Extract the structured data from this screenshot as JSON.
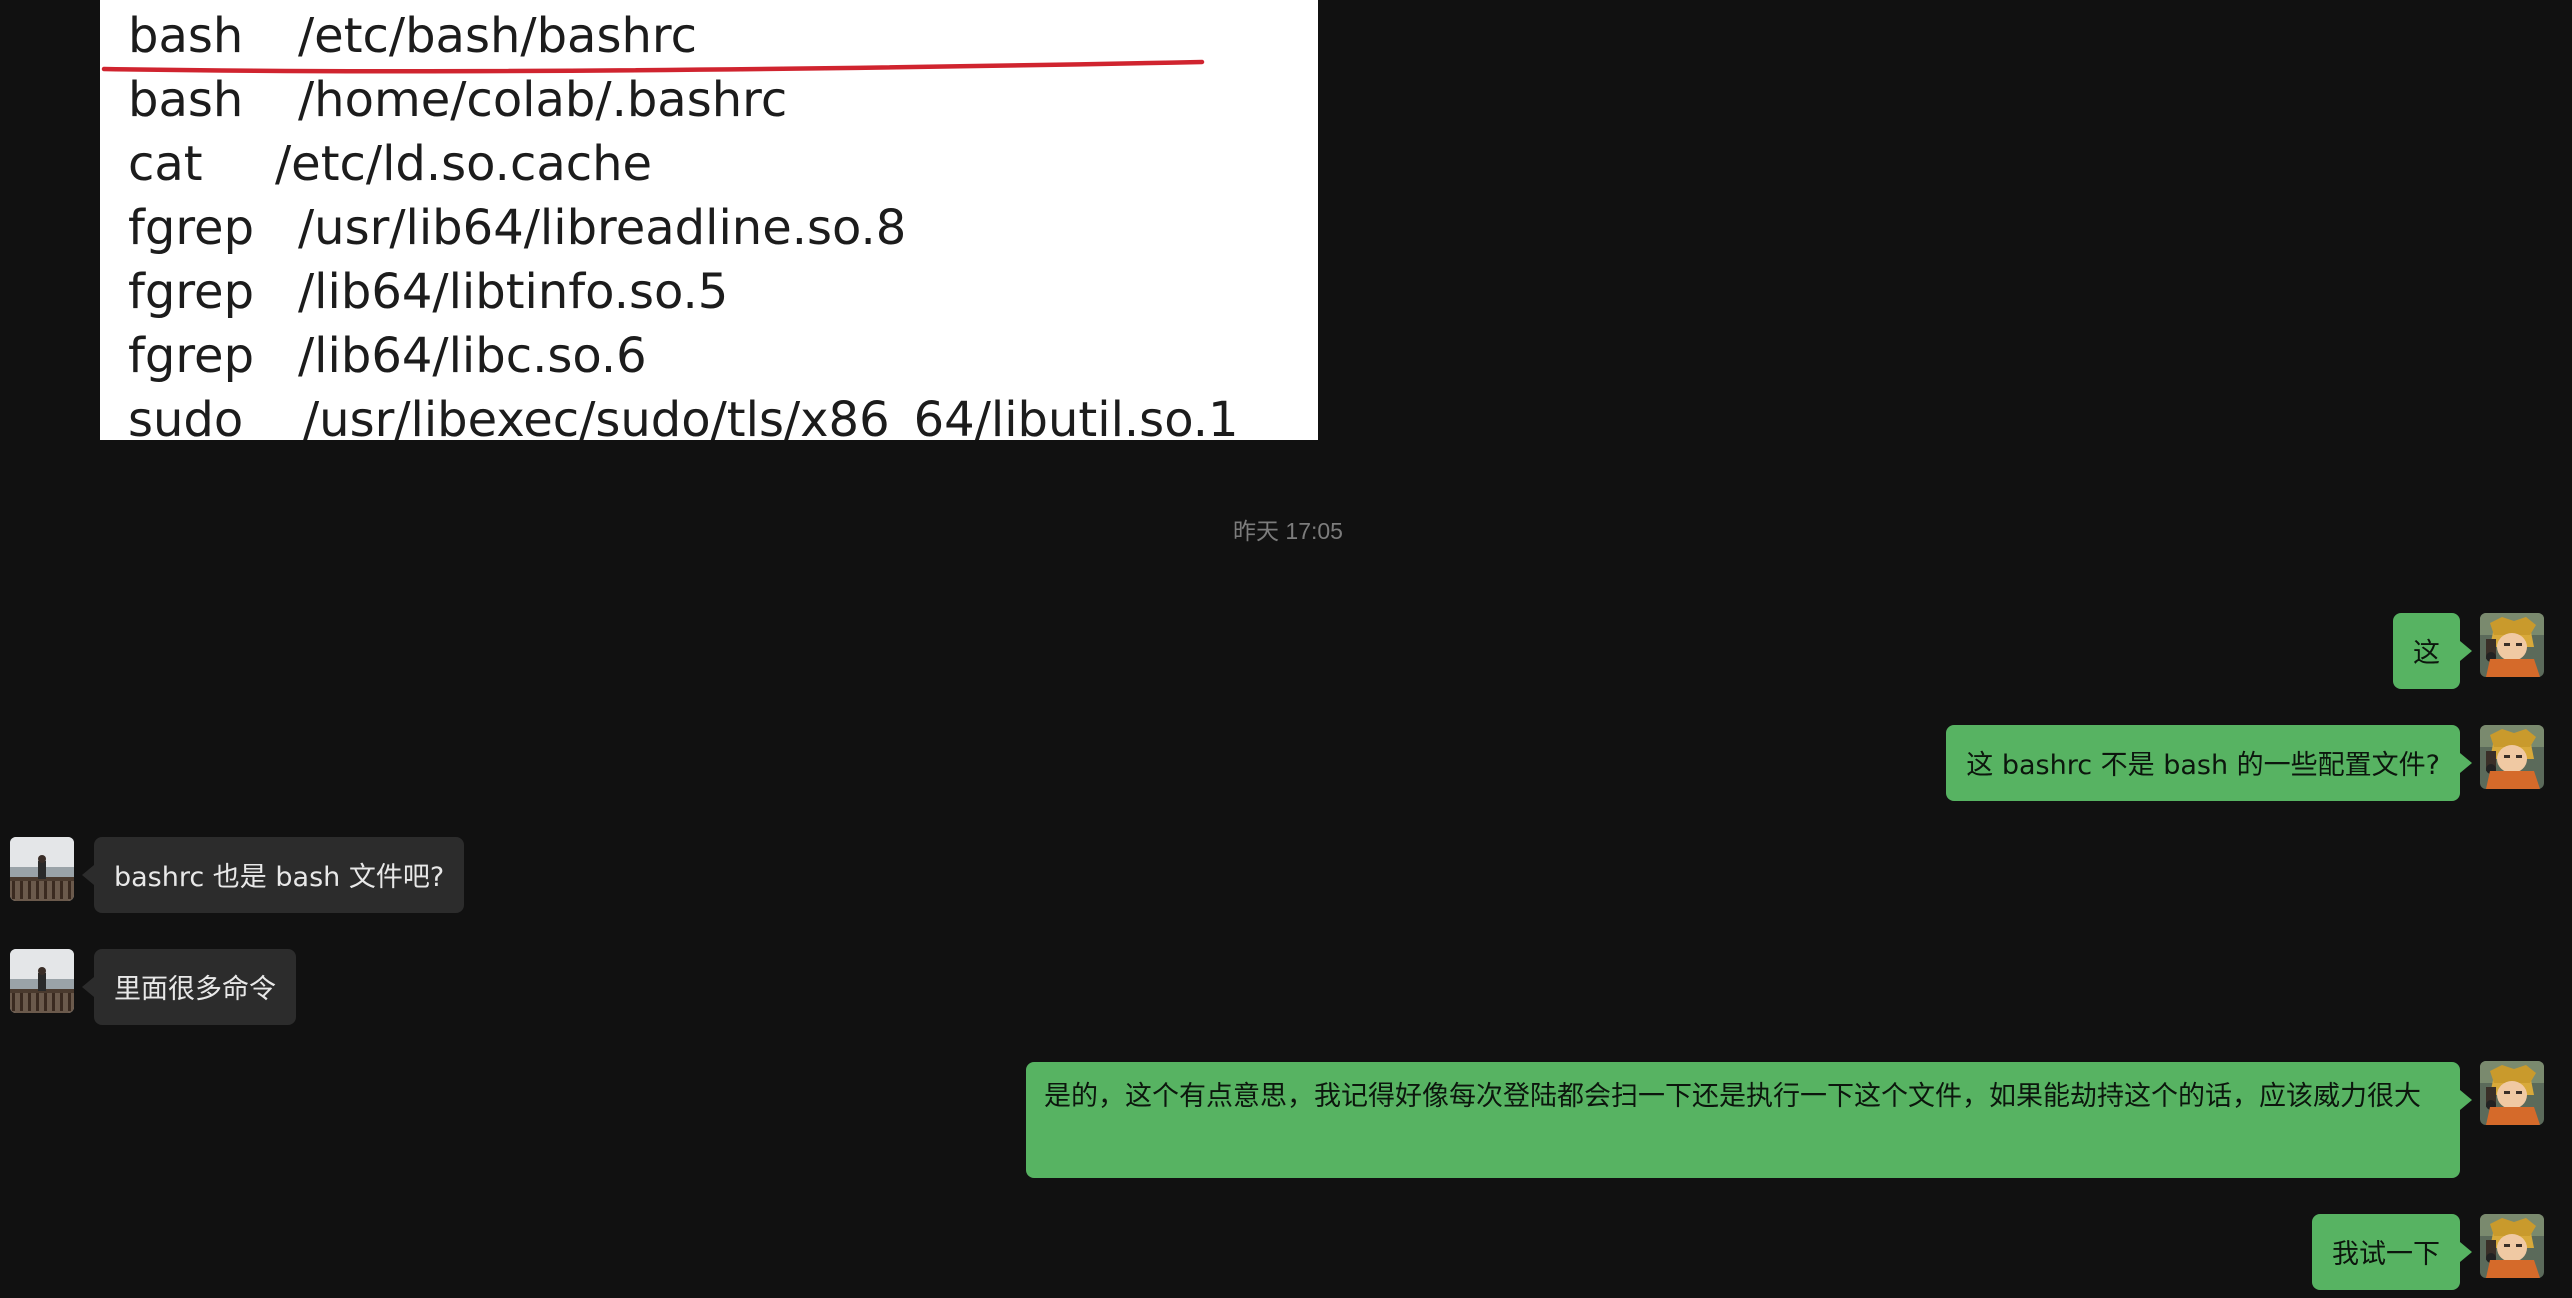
{
  "shared_image": {
    "lines": [
      {
        "cmd": "bash",
        "path": "/etc/bash/bashrc"
      },
      {
        "cmd": "bash",
        "path": "/home/colab/.bashrc"
      },
      {
        "cmd": "cat",
        "path": "/etc/ld.so.cache"
      },
      {
        "cmd": "fgrep",
        "path": "/usr/lib64/libreadline.so.8"
      },
      {
        "cmd": "fgrep",
        "path": "/lib64/libtinfo.so.5"
      },
      {
        "cmd": "fgrep",
        "path": "/lib64/libc.so.6"
      },
      {
        "cmd": "sudo",
        "path": "/usr/libexec/sudo/tls/x86_64/libutil.so.1"
      }
    ],
    "highlight_color": "#d0242f"
  },
  "timestamp": "昨天 17:05",
  "messages": [
    {
      "sender": "self",
      "text": "这"
    },
    {
      "sender": "self",
      "text": "这 bashrc 不是 bash 的一些配置文件?"
    },
    {
      "sender": "peer",
      "text": "bashrc 也是 bash 文件吧?"
    },
    {
      "sender": "peer",
      "text": "里面很多命令"
    },
    {
      "sender": "self",
      "text": "是的，这个有点意思，我记得好像每次登陆都会扫一下还是执行一下这个文件，如果能劫持这个的话，应该威力很大"
    },
    {
      "sender": "self",
      "text": "我试一下"
    }
  ],
  "colors": {
    "background": "#111111",
    "outgoing_bubble": "#57b362",
    "incoming_bubble": "#2c2c2c",
    "timestamp": "#7c7c7c"
  },
  "icons": {
    "self_avatar": "anime-character-avatar-icon",
    "peer_avatar": "landscape-photo-avatar-icon"
  }
}
